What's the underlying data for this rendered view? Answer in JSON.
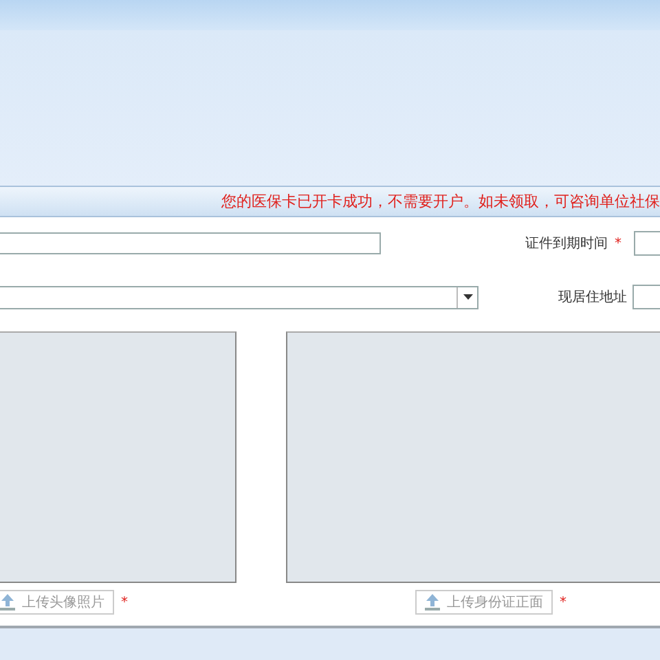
{
  "notice": "您的医保卡已开卡成功，不需要开户。如未领取，可咨询单位社保",
  "rows": [
    {
      "kind": "text",
      "label": "证件到期时间",
      "required": true
    },
    {
      "kind": "select",
      "label": "现居住地址",
      "required": false
    }
  ],
  "uploads": [
    {
      "button": "上传头像照片",
      "required": true
    },
    {
      "button": "上传身份证正面",
      "required": true
    }
  ],
  "required_mark": "*"
}
